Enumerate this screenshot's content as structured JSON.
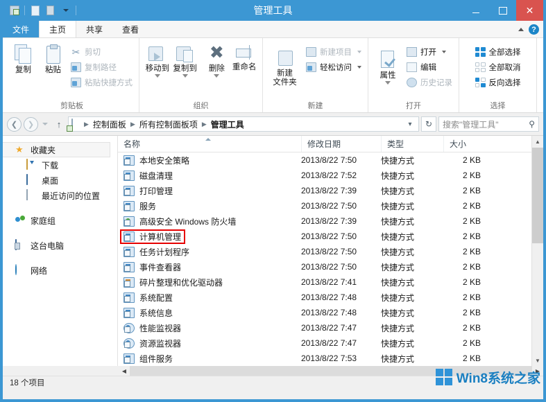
{
  "window": {
    "title": "管理工具",
    "controls": {
      "minimize": "—",
      "maximize": "□",
      "close": "✕"
    },
    "quick_access": [
      "app-icon",
      "new-item-icon",
      "properties-icon",
      "dropdown-caret"
    ],
    "accent_color": "#3c97d3"
  },
  "ribbon": {
    "tabs": [
      {
        "label": "文件",
        "kind": "file"
      },
      {
        "label": "主页",
        "kind": "active"
      },
      {
        "label": "共享",
        "kind": "normal"
      },
      {
        "label": "查看",
        "kind": "normal"
      }
    ],
    "collapse_icon": "chevron-up-icon",
    "help_icon": "?",
    "groups": [
      {
        "title": "剪贴板",
        "big": [
          {
            "label": "复制",
            "icon": "copy-icon"
          },
          {
            "label": "粘贴",
            "icon": "paste-icon"
          }
        ],
        "small": [
          {
            "label": "剪切",
            "icon": "scissors-icon",
            "dim": true
          },
          {
            "label": "复制路径",
            "icon": "copy-path-icon",
            "dim": true
          },
          {
            "label": "粘贴快捷方式",
            "icon": "paste-shortcut-icon",
            "dim": true
          }
        ]
      },
      {
        "title": "组织",
        "big": [
          {
            "label": "移动到",
            "icon": "move-to-icon",
            "caret": true
          },
          {
            "label": "复制到",
            "icon": "copy-to-icon",
            "caret": true
          },
          {
            "label": "删除",
            "icon": "delete-icon",
            "caret": true
          },
          {
            "label": "重命名",
            "icon": "rename-icon"
          }
        ],
        "small": []
      },
      {
        "title": "新建",
        "big": [
          {
            "label": "新建\n文件夹",
            "icon": "new-folder-icon"
          }
        ],
        "small": [
          {
            "label": "新建项目",
            "icon": "new-item-icon",
            "caret": true,
            "dim": true
          },
          {
            "label": "轻松访问",
            "icon": "easy-access-icon",
            "caret": true
          }
        ]
      },
      {
        "title": "打开",
        "big": [
          {
            "label": "属性",
            "icon": "properties-icon",
            "caret": true
          }
        ],
        "small": [
          {
            "label": "打开",
            "icon": "open-icon",
            "caret": true
          },
          {
            "label": "编辑",
            "icon": "edit-icon"
          },
          {
            "label": "历史记录",
            "icon": "history-icon",
            "dim": true
          }
        ]
      },
      {
        "title": "选择",
        "big": [],
        "small": [
          {
            "label": "全部选择",
            "icon": "select-all-icon"
          },
          {
            "label": "全部取消",
            "icon": "select-none-icon"
          },
          {
            "label": "反向选择",
            "icon": "invert-selection-icon"
          }
        ]
      }
    ]
  },
  "address_bar": {
    "back_icon": "back-arrow-icon",
    "forward_icon": "forward-arrow-icon",
    "recent_caret_icon": "chevron-down-icon",
    "up_icon": "up-arrow-icon",
    "path_icon": "admin-tools-icon",
    "breadcrumbs": [
      "控制面板",
      "所有控制面板项",
      "管理工具"
    ],
    "path_dropdown_icon": "chevron-down-icon",
    "refresh_icon": "refresh-icon",
    "search": {
      "placeholder": "搜索\"管理工具\"",
      "icon": "search-icon"
    }
  },
  "nav_pane": {
    "items": [
      {
        "label": "收藏夹",
        "icon": "star-icon",
        "level": 0,
        "selected": true
      },
      {
        "label": "下载",
        "icon": "downloads-icon",
        "level": 1
      },
      {
        "label": "桌面",
        "icon": "desktop-icon",
        "level": 1
      },
      {
        "label": "最近访问的位置",
        "icon": "recent-places-icon",
        "level": 1
      },
      {
        "label": "家庭组",
        "icon": "homegroup-icon",
        "level": 0,
        "gap_before": true
      },
      {
        "label": "这台电脑",
        "icon": "this-pc-icon",
        "level": 0,
        "gap_before": true
      },
      {
        "label": "网络",
        "icon": "network-icon",
        "level": 0,
        "gap_before": true
      }
    ]
  },
  "file_list": {
    "columns": [
      "名称",
      "修改日期",
      "类型",
      "大小"
    ],
    "sort_column": "名称",
    "sort_direction": "ascending",
    "highlighted_row_index": 5,
    "rows": [
      {
        "name": "本地安全策略",
        "date": "2013/8/22 7:50",
        "type": "快捷方式",
        "size": "2 KB",
        "icon": "mmc-shortcut-icon"
      },
      {
        "name": "磁盘清理",
        "date": "2013/8/22 7:52",
        "type": "快捷方式",
        "size": "2 KB",
        "icon": "disk-cleanup-shortcut-icon"
      },
      {
        "name": "打印管理",
        "date": "2013/8/22 7:39",
        "type": "快捷方式",
        "size": "2 KB",
        "icon": "print-management-shortcut-icon"
      },
      {
        "name": "服务",
        "date": "2013/8/22 7:50",
        "type": "快捷方式",
        "size": "2 KB",
        "icon": "services-shortcut-icon"
      },
      {
        "name": "高级安全 Windows 防火墙",
        "date": "2013/8/22 7:39",
        "type": "快捷方式",
        "size": "2 KB",
        "icon": "firewall-shortcut-icon"
      },
      {
        "name": "计算机管理",
        "date": "2013/8/22 7:50",
        "type": "快捷方式",
        "size": "2 KB",
        "icon": "computer-management-shortcut-icon"
      },
      {
        "name": "任务计划程序",
        "date": "2013/8/22 7:50",
        "type": "快捷方式",
        "size": "2 KB",
        "icon": "task-scheduler-shortcut-icon"
      },
      {
        "name": "事件查看器",
        "date": "2013/8/22 7:50",
        "type": "快捷方式",
        "size": "2 KB",
        "icon": "event-viewer-shortcut-icon"
      },
      {
        "name": "碎片整理和优化驱动器",
        "date": "2013/8/22 7:41",
        "type": "快捷方式",
        "size": "2 KB",
        "icon": "defragment-shortcut-icon"
      },
      {
        "name": "系统配置",
        "date": "2013/8/22 7:48",
        "type": "快捷方式",
        "size": "2 KB",
        "icon": "system-config-shortcut-icon"
      },
      {
        "name": "系统信息",
        "date": "2013/8/22 7:48",
        "type": "快捷方式",
        "size": "2 KB",
        "icon": "system-info-shortcut-icon"
      },
      {
        "name": "性能监视器",
        "date": "2013/8/22 7:47",
        "type": "快捷方式",
        "size": "2 KB",
        "icon": "performance-monitor-shortcut-icon"
      },
      {
        "name": "资源监视器",
        "date": "2013/8/22 7:47",
        "type": "快捷方式",
        "size": "2 KB",
        "icon": "resource-monitor-shortcut-icon"
      },
      {
        "name": "组件服务",
        "date": "2013/8/22 7:53",
        "type": "快捷方式",
        "size": "2 KB",
        "icon": "component-services-shortcut-icon"
      }
    ]
  },
  "status_bar": {
    "item_count_text": "18 个项目"
  },
  "watermark": {
    "text": "Win8系统之家",
    "logo": "windows-logo-icon",
    "color": "#1a7fc1"
  },
  "scrollbars": {
    "vertical_up_icon": "chevron-up-icon",
    "vertical_down_icon": "chevron-down-icon",
    "horizontal_left_icon": "chevron-left-icon",
    "horizontal_right_icon": "chevron-right-icon"
  }
}
